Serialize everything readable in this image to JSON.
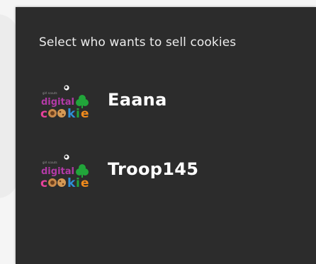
{
  "dialog": {
    "title": "Select who wants to sell cookies",
    "options": [
      {
        "label": "Eaana",
        "icon": "digital-cookie-logo-icon"
      },
      {
        "label": "Troop145",
        "icon": "digital-cookie-logo-icon"
      }
    ]
  },
  "colors": {
    "dialog_bg": "#2c2c2c",
    "text": "#ffffff",
    "logo_purple": "#b23aa6",
    "logo_green": "#21a53a",
    "logo_orange": "#f08a1c",
    "logo_pink": "#e8429b"
  }
}
